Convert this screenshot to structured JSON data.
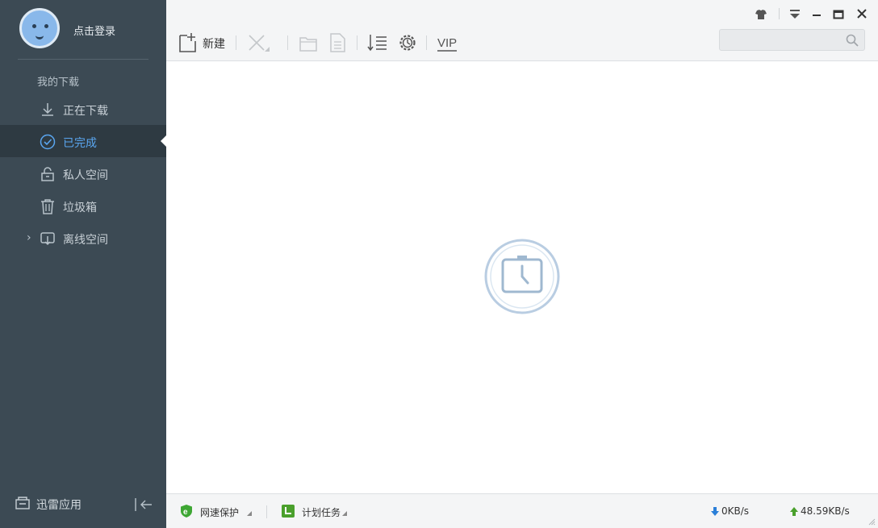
{
  "user": {
    "login_label": "点击登录"
  },
  "sidebar": {
    "section_title": "我的下载",
    "items": [
      {
        "label": "正在下载",
        "icon": "download-arrow-icon",
        "active": false
      },
      {
        "label": "已完成",
        "icon": "check-circle-icon",
        "active": true
      },
      {
        "label": "私人空间",
        "icon": "lock-icon",
        "active": false
      },
      {
        "label": "垃圾箱",
        "icon": "trash-icon",
        "active": false
      },
      {
        "label": "离线空间",
        "icon": "cloud-download-icon",
        "active": false,
        "expandable": true
      }
    ],
    "apps_label": "迅雷应用"
  },
  "toolbar": {
    "new_label": "新建",
    "buttons": [
      "new-task-icon",
      "delete-icon",
      "open-folder-icon",
      "open-file-icon",
      "sort-icon",
      "settings-gear-icon",
      "vip-icon"
    ],
    "search": {
      "value": "",
      "placeholder": ""
    }
  },
  "window_controls": [
    "skin-icon",
    "menu-icon",
    "minimize-icon",
    "maximize-icon",
    "close-icon"
  ],
  "main": {
    "state": "loading"
  },
  "statusbar": {
    "protection_label": "网速保护",
    "schedule_label": "计划任务",
    "download_speed": "0KB/s",
    "upload_speed": "48.59KB/s"
  },
  "colors": {
    "sidebar_bg": "#3c4a54",
    "sidebar_active_bg": "#2e3a42",
    "accent": "#5aa6f0",
    "shield_green": "#3ea734",
    "download_blue": "#2a7fd8",
    "upload_green": "#4aa02c"
  }
}
